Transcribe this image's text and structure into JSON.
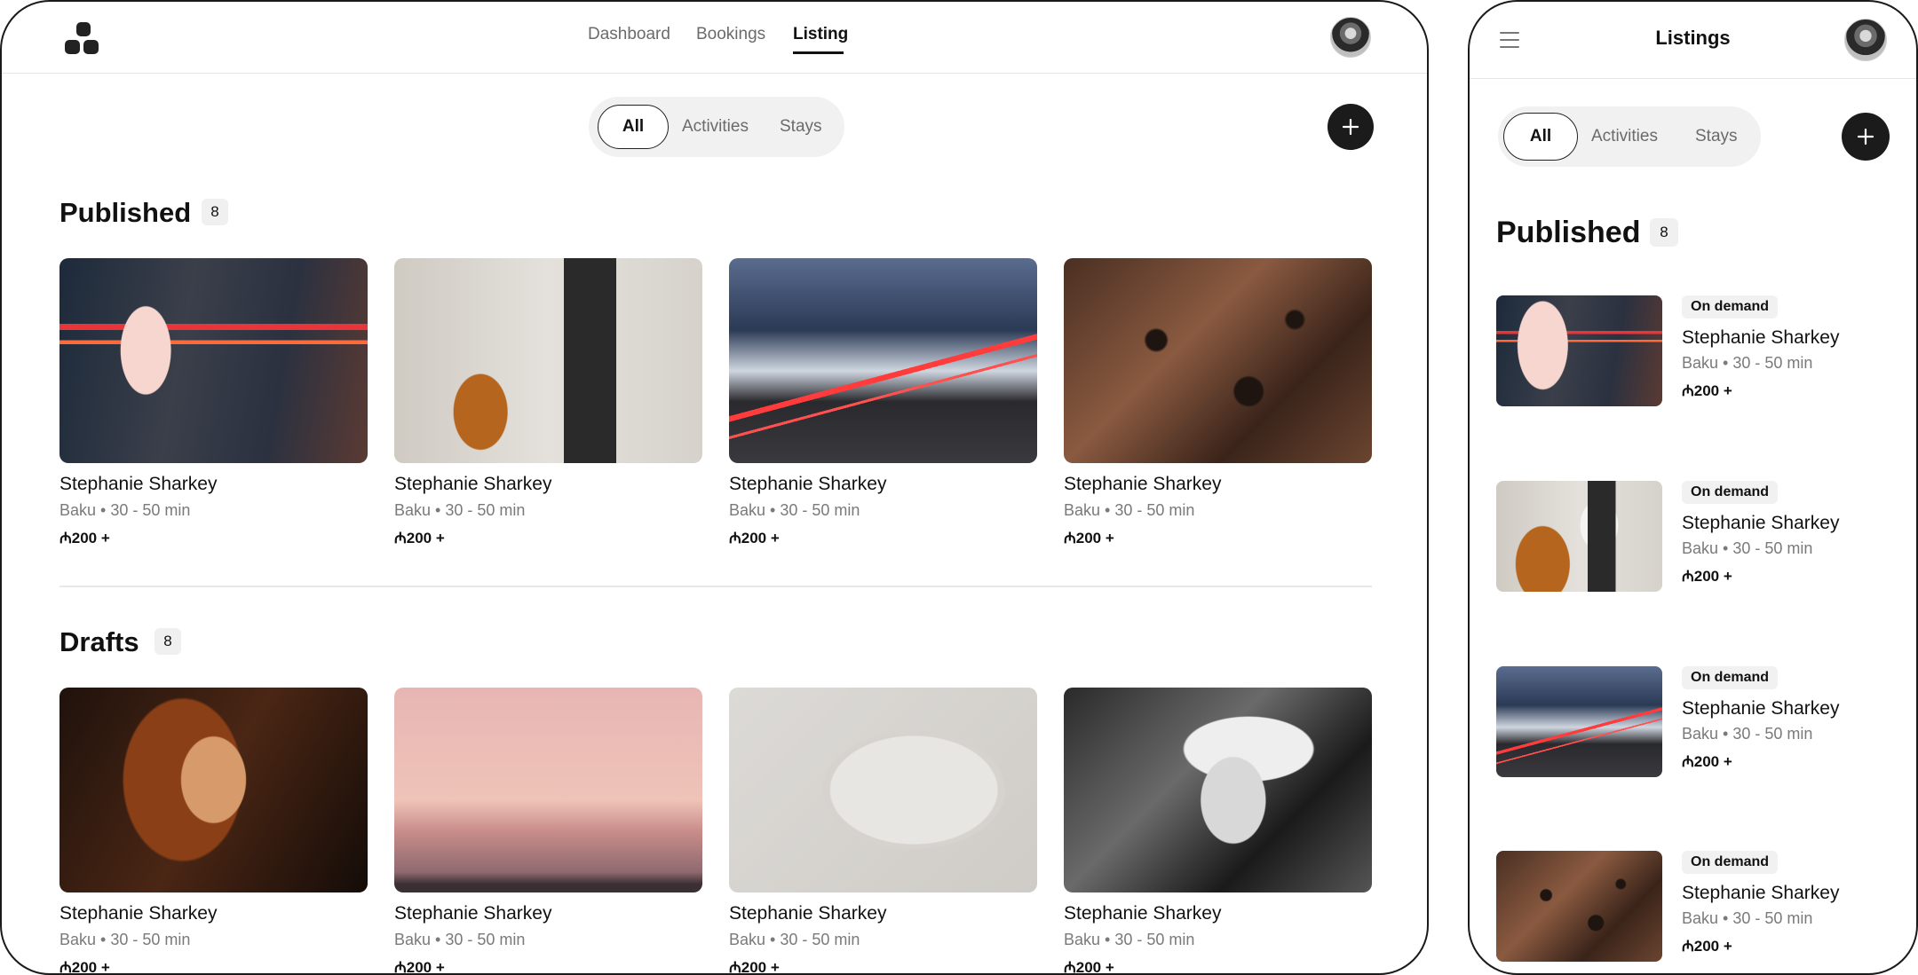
{
  "desktop": {
    "nav": {
      "items": [
        "Dashboard",
        "Bookings",
        "Listing"
      ],
      "active": "Listing"
    },
    "filter": {
      "options": [
        "All",
        "Activities",
        "Stays"
      ],
      "selected": "All"
    },
    "published": {
      "title": "Published",
      "count": "8",
      "cards": [
        {
          "image": "night-street-lanterns",
          "name": "Stephanie Sharkey",
          "meta": "Baku • 30 - 50 min",
          "price": "₼200 +"
        },
        {
          "image": "man-with-dog-and-bike",
          "name": "Stephanie Sharkey",
          "meta": "Baku • 30 - 50 min",
          "price": "₼200 +"
        },
        {
          "image": "snowy-road-light-trails",
          "name": "Stephanie Sharkey",
          "meta": "Baku • 30 - 50 min",
          "price": "₼200 +"
        },
        {
          "image": "aerial-terrain",
          "name": "Stephanie Sharkey",
          "meta": "Baku • 30 - 50 min",
          "price": "₼200 +"
        }
      ]
    },
    "drafts": {
      "title": "Drafts",
      "count": "8",
      "cards": [
        {
          "image": "woman-portrait-warm",
          "name": "Stephanie Sharkey",
          "meta": "Baku • 30 - 50 min",
          "price": "₼200 +"
        },
        {
          "image": "pink-sunset-sea",
          "name": "Stephanie Sharkey",
          "meta": "Baku • 30 - 50 min",
          "price": "₼200 +"
        },
        {
          "image": "white-abstract-arch",
          "name": "Stephanie Sharkey",
          "meta": "Baku • 30 - 50 min",
          "price": "₼200 +"
        },
        {
          "image": "bw-woman-foliage",
          "name": "Stephanie Sharkey",
          "meta": "Baku • 30 - 50 min",
          "price": "₼200 +"
        }
      ]
    }
  },
  "mobile": {
    "title": "Listings",
    "filter": {
      "options": [
        "All",
        "Activities",
        "Stays"
      ],
      "selected": "All"
    },
    "published": {
      "title": "Published",
      "count": "8",
      "items": [
        {
          "image": "night-street-lanterns",
          "tag": "On demand",
          "name": "Stephanie Sharkey",
          "meta": "Baku • 30 - 50 min",
          "price": "₼200 +"
        },
        {
          "image": "man-with-dog-and-bike",
          "tag": "On demand",
          "name": "Stephanie Sharkey",
          "meta": "Baku • 30 - 50 min",
          "price": "₼200 +"
        },
        {
          "image": "snowy-road-light-trails",
          "tag": "On demand",
          "name": "Stephanie Sharkey",
          "meta": "Baku • 30 - 50 min",
          "price": "₼200 +"
        },
        {
          "image": "aerial-terrain",
          "tag": "On demand",
          "name": "Stephanie Sharkey",
          "meta": "Baku • 30 - 50 min",
          "price": "₼200 +"
        }
      ]
    }
  },
  "icons": {
    "logo": "four-blocks-logo-icon",
    "add": "plus-icon",
    "menu": "hamburger-menu-icon",
    "avatar": "user-avatar"
  },
  "colors": {
    "primary": "#1b1b1b",
    "muted": "#7a7a7a",
    "chip": "#f1f1f1"
  }
}
